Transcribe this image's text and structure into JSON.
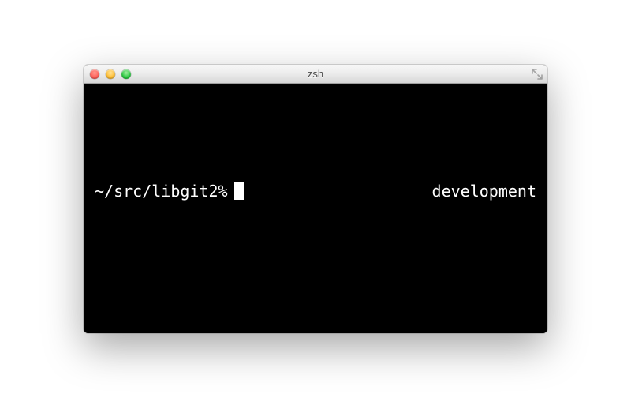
{
  "window": {
    "title": "zsh"
  },
  "terminal": {
    "prompt_left": "~/src/libgit2%",
    "prompt_right": "development"
  }
}
